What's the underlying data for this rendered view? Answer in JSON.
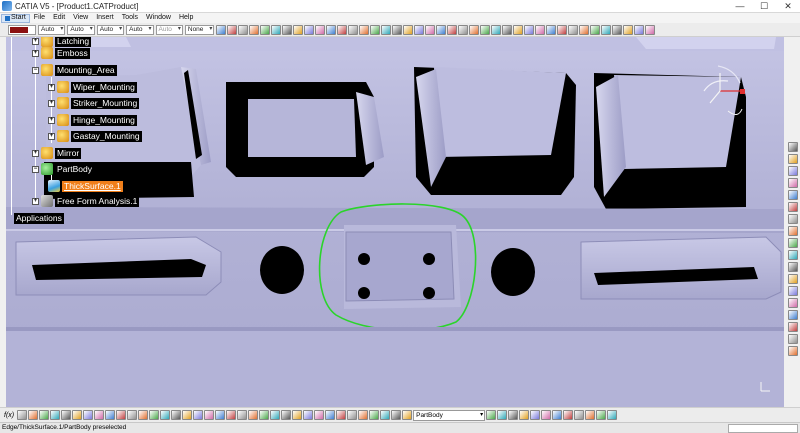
{
  "window": {
    "title": "CATIA V5 - [Product1.CATProduct]",
    "minimize": "—",
    "maximize": "☐",
    "close": "✕"
  },
  "menu": {
    "items": [
      "Start",
      "File",
      "Edit",
      "View",
      "Insert",
      "Tools",
      "Window",
      "Help"
    ]
  },
  "properties": {
    "color": "#8b1010",
    "combos": [
      "Auto",
      "Auto",
      "Auto",
      "Auto",
      "Auto",
      "None"
    ]
  },
  "tree": {
    "nodes": [
      {
        "label": "Latching",
        "level": 2,
        "expander": "+",
        "icon": "product-gear-icon"
      },
      {
        "label": "Emboss",
        "level": 2,
        "expander": "+",
        "icon": "product-gear-icon"
      },
      {
        "label": "Mounting_Area",
        "level": 2,
        "expander": "−",
        "icon": "product-gear-icon"
      },
      {
        "label": "Wiper_Mounting",
        "level": 3,
        "expander": "+",
        "icon": "product-gear-icon"
      },
      {
        "label": "Striker_Mounting",
        "level": 3,
        "expander": "+",
        "icon": "product-gear-icon"
      },
      {
        "label": "Hinge_Mounting",
        "level": 3,
        "expander": "+",
        "icon": "product-gear-icon"
      },
      {
        "label": "Gastay_Mounting",
        "level": 3,
        "expander": "+",
        "icon": "product-gear-icon"
      },
      {
        "label": "Mirror",
        "level": 2,
        "expander": "+",
        "icon": "product-gear-icon"
      },
      {
        "label": "PartBody",
        "level": 2,
        "expander": "−",
        "icon": "partbody-gear-icon"
      },
      {
        "label": "ThickSurface.1",
        "level": 3,
        "expander": "",
        "icon": "thick-surface-icon",
        "selected": true
      },
      {
        "label": "Free Form Analysis.1",
        "level": 2,
        "expander": "+",
        "icon": "analysis-icon"
      },
      {
        "label": "Applications",
        "level": 0,
        "expander": "",
        "icon": ""
      }
    ]
  },
  "bottom": {
    "fog_label": "f(x)",
    "current_body": "PartBody"
  },
  "status": {
    "text": "Edge/ThickSurface.1/PartBody preselected"
  },
  "colors": {
    "viewport": "#b0b0d4",
    "highlight": "#2bd42b",
    "selected": "#f07f1a"
  }
}
